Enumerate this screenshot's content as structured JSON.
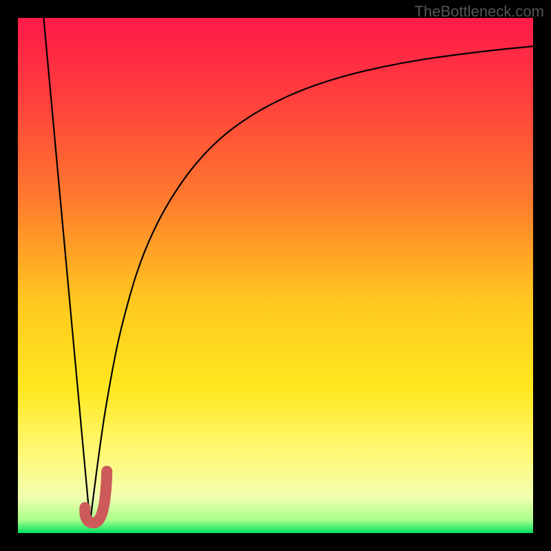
{
  "watermark": "TheBottleneck.com",
  "chart_data": {
    "type": "line",
    "title": "",
    "xlabel": "",
    "ylabel": "",
    "xlim": [
      0,
      100
    ],
    "ylim": [
      0,
      100
    ],
    "gradient_stops": [
      {
        "offset": 0,
        "color": "#ff1a4a"
      },
      {
        "offset": 0.15,
        "color": "#ff3d3d"
      },
      {
        "offset": 0.35,
        "color": "#ff7a2e"
      },
      {
        "offset": 0.55,
        "color": "#ffc81f"
      },
      {
        "offset": 0.72,
        "color": "#ffe81f"
      },
      {
        "offset": 0.85,
        "color": "#fff97a"
      },
      {
        "offset": 0.93,
        "color": "#f2ffb0"
      },
      {
        "offset": 0.975,
        "color": "#a8ff8a"
      },
      {
        "offset": 1,
        "color": "#00e060"
      }
    ],
    "series": [
      {
        "name": "left-falling-line",
        "x": [
          5,
          14
        ],
        "y": [
          100,
          2
        ]
      },
      {
        "name": "right-log-curve",
        "x": [
          14,
          16,
          18,
          20,
          24,
          30,
          38,
          48,
          60,
          75,
          90,
          100
        ],
        "y": [
          2,
          18,
          30,
          40,
          54,
          66,
          76,
          83,
          88,
          91.5,
          93.5,
          94.5
        ]
      }
    ],
    "marker": {
      "shape": "J",
      "color": "#cc5a5a",
      "x_range": [
        12.5,
        17
      ],
      "y_range": [
        2,
        12
      ]
    }
  }
}
